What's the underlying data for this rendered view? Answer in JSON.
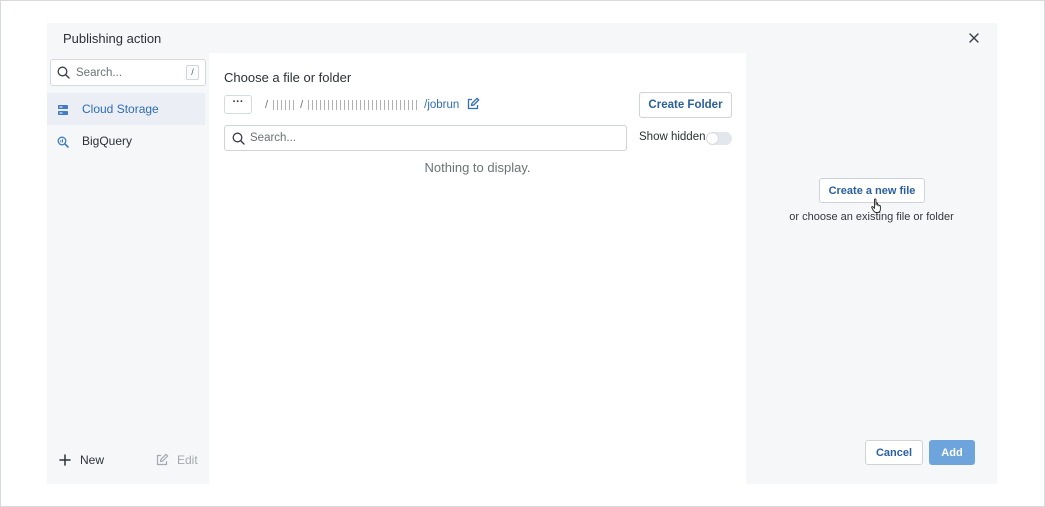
{
  "dialog": {
    "title": "Publishing action"
  },
  "sidebar": {
    "search_placeholder": "Search...",
    "search_shortcut": "/",
    "items": [
      {
        "label": "Cloud Storage",
        "icon": "storage-icon",
        "active": true
      },
      {
        "label": "BigQuery",
        "icon": "bigquery-icon",
        "active": false
      }
    ],
    "new_label": "New",
    "edit_label": "Edit"
  },
  "main": {
    "title": "Choose a file or folder",
    "more_label": "···",
    "breadcrumb_last": "/jobrun",
    "create_folder_label": "Create Folder",
    "search_placeholder": "Search...",
    "show_hidden_label": "Show hidden",
    "show_hidden": false,
    "empty_message": "Nothing to display."
  },
  "right": {
    "create_file_label": "Create a new file",
    "choose_text": "or choose an existing file or folder",
    "cancel_label": "Cancel",
    "add_label": "Add"
  },
  "colors": {
    "accent": "#2f6db5",
    "primary_button": "#6ea4dc",
    "panel_bg": "#f5f7f9"
  }
}
